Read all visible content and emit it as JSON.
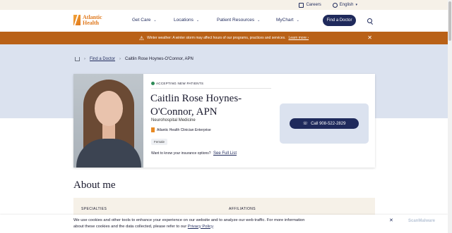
{
  "utility": {
    "careers": "Careers",
    "language": "English"
  },
  "logo": {
    "line1": "Atlantic",
    "line2": "Health"
  },
  "nav": {
    "items": [
      "Get Care",
      "Locations",
      "Patient Resources",
      "MyChart"
    ],
    "cta": "Find a Doctor"
  },
  "alert": {
    "message": "Winter weather: A winter storm may affect hours of our programs, practices and services.",
    "link": "Learn more ›"
  },
  "breadcrumb": {
    "parent": "Find a Doctor",
    "current": "Caitlin Rose Hoynes-O'Connor, APN"
  },
  "doctor": {
    "status": "ACCEPTING NEW PATIENTS",
    "name": "Caitlin Rose Hoynes-O'Connor, APN",
    "specialty": "Neurohospital Medicine",
    "enterprise": "Atlantic Health Clinician Enterprise",
    "gender": "Female",
    "insurance_prompt": "Want to know your insurance options?",
    "insurance_link": "See Full List"
  },
  "call": {
    "label": "Call 908-522-2829"
  },
  "about": {
    "heading": "About me",
    "specialties_label": "SPECIALTIES",
    "affiliations_label": "AFFILIATIONS"
  },
  "cookie": {
    "text": "We use cookies and other tools to enhance your experience on our website and to analyze our web traffic. For more information about these cookies and the data collected, please refer to our",
    "link": "Privacy Policy",
    "end": "."
  },
  "watermark": "ScanMalware",
  "colors": {
    "navy": "#1f2a5c",
    "alert": "#b96117",
    "band": "#dbe2ef",
    "cream": "#f6f1e8",
    "brand_orange": "#e07a1f"
  }
}
